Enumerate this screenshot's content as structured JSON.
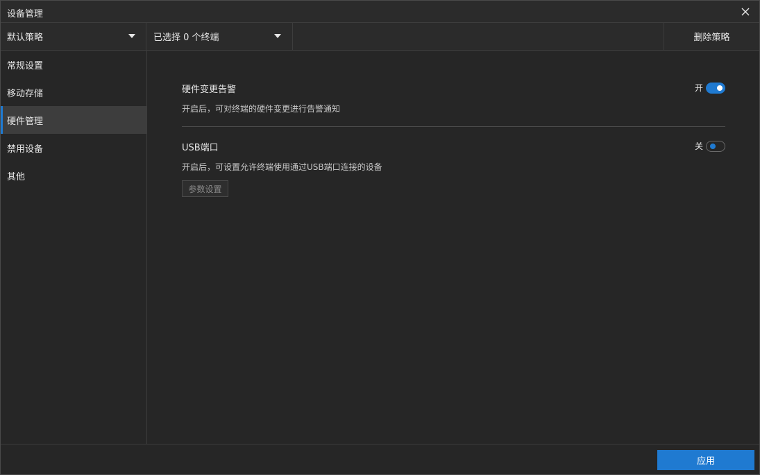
{
  "window": {
    "title": "设备管理",
    "close_icon": "close-icon"
  },
  "toolbar": {
    "policy_select": "默认策略",
    "terminal_select": "已选择 0 个终端",
    "delete_label": "删除策略"
  },
  "sidebar": {
    "active_index": 2,
    "items": [
      {
        "label": "常规设置"
      },
      {
        "label": "移动存储"
      },
      {
        "label": "硬件管理"
      },
      {
        "label": "禁用设备"
      },
      {
        "label": "其他"
      }
    ]
  },
  "hardware_alert": {
    "title": "硬件变更告警",
    "description": "开启后，可对终端的硬件变更进行告警通知",
    "toggle_label": "开",
    "enabled": true
  },
  "usb_port": {
    "title": "USB端口",
    "description": "开启后，可设置允许终端使用通过USB端口连接的设备",
    "toggle_label": "关",
    "enabled": false,
    "param_button": "参数设置"
  },
  "footer": {
    "apply_label": "应用"
  },
  "colors": {
    "accent": "#1f7ad1",
    "background": "#262626",
    "panel": "#2b2b2b"
  }
}
